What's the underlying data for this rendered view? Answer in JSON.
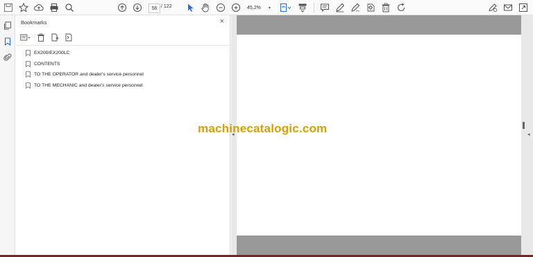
{
  "toolbar": {
    "current_page": "56",
    "total_pages": "/ 122",
    "zoom": "45,2%"
  },
  "bookmarks_panel": {
    "title": "Bookmarks",
    "close_glyph": "×",
    "items": [
      {
        "label": "EX200/EX200LC"
      },
      {
        "label": "CONTENTS"
      },
      {
        "label": "TO THE OPERATOR and dealer's service personnel"
      },
      {
        "label": "TO THE MECHANIC and dealer's service personnel"
      }
    ]
  },
  "document": {
    "watermark": "machinecatalogic.com"
  },
  "colors": {
    "watermark": "#d4a00a",
    "page_gray": "#999999",
    "accent_blue": "#2a6bd6"
  }
}
